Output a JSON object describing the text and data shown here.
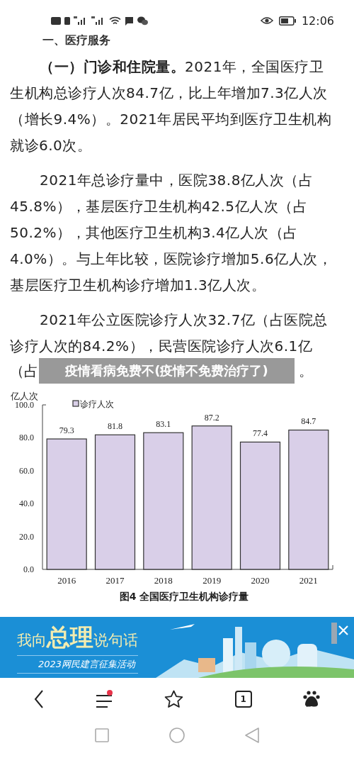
{
  "status_bar": {
    "time": "12:06"
  },
  "document": {
    "heading": "一、医疗服务",
    "paragraphs": [
      "**（一）门诊和住院量。**2021年，全国医疗卫生机构总诊疗人次84.7亿，比上年增加7.3亿人次（增长9.4%）。2021年居民平均到医疗卫生机构就诊6.0次。",
      "2021年总诊疗量中，医院38.8亿人次（占45.8%），基层医疗卫生机构42.5亿人次（占50.2%），其他医疗卫生机构3.4亿人次（占4.0%）。与上年比较，医院诊疗增加5.6亿人次，基层医疗卫生机构诊疗增加1.3亿人次。",
      "2021年公立医院诊疗人次32.7亿（占医院总诊疗人次的84.2%），民营医院诊疗人次6.1亿"
    ],
    "covered_line": {
      "before": "（占",
      "after": "。"
    },
    "chart": {
      "chart_data": {
        "type": "bar",
        "ylabel": "亿人次",
        "categories": [
          "2016",
          "2017",
          "2018",
          "2019",
          "2020",
          "2021"
        ],
        "series": [
          {
            "name": "诊疗人次",
            "color": "#d9cfe8",
            "values": [
              79.3,
              81.8,
              83.1,
              87.2,
              77.4,
              84.7
            ]
          }
        ],
        "ylim": [
          0,
          100
        ],
        "yticks": [
          {
            "value": 0,
            "label": "0.0"
          },
          {
            "value": 20,
            "label": "20.0"
          },
          {
            "value": 40,
            "label": "40.0"
          },
          {
            "value": 60,
            "label": "60.0"
          },
          {
            "value": 80,
            "label": "80.0"
          },
          {
            "value": 100,
            "label": "100.0"
          }
        ],
        "data_labels": true
      },
      "caption": "图4  全国医疗卫生机构诊疗量"
    }
  },
  "overlay_title": "疫情看病免费不(疫情不免费治疗了)",
  "banner": {
    "headline": [
      {
        "text": "我向",
        "kind": "plain"
      },
      {
        "text": "总理",
        "kind": "emphasis"
      },
      {
        "text": "说句话",
        "kind": "plain"
      }
    ],
    "subtitle": "2023网民建言征集活动"
  },
  "toolbar": {
    "menu_notification": true,
    "tab_count": "1"
  }
}
